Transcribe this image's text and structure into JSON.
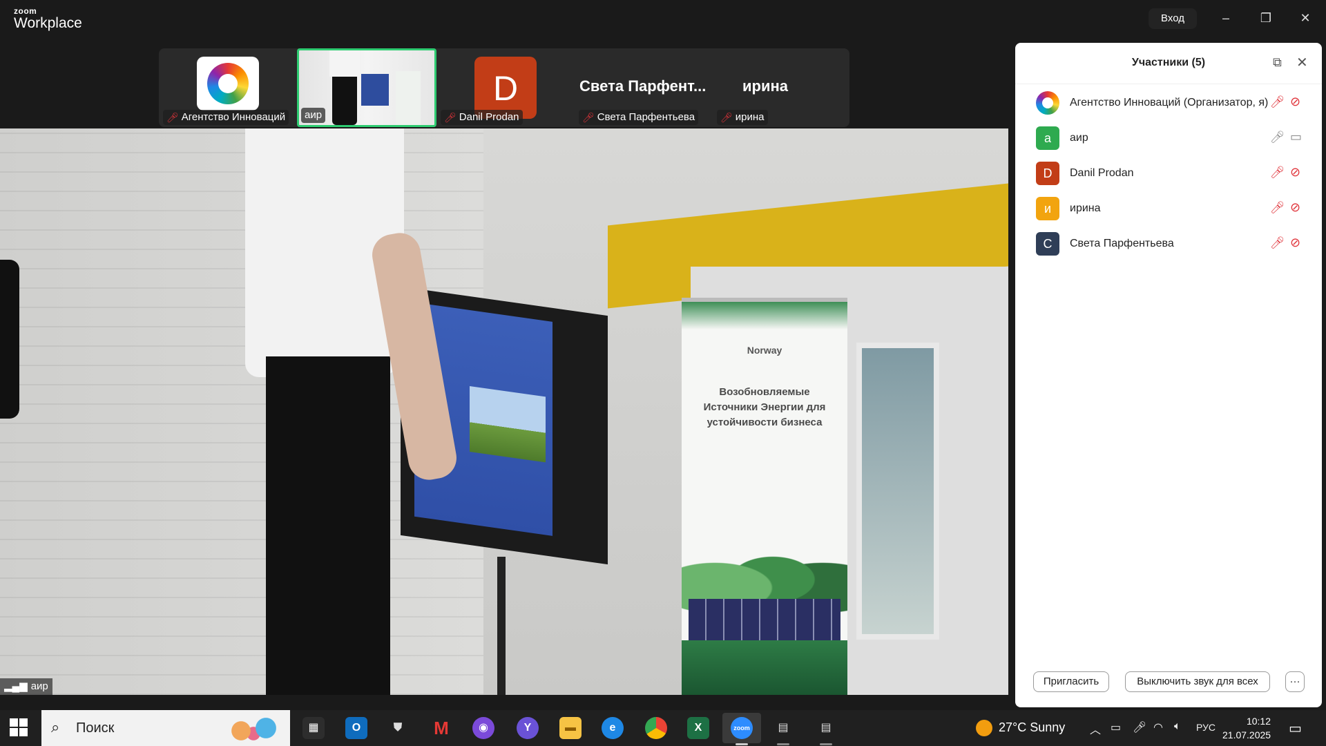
{
  "window": {
    "brand_top": "zoom",
    "brand_bottom": "Workplace",
    "signin_label": "Вход",
    "minimize_icon": "–",
    "restore_icon": "❐",
    "close_icon": "✕"
  },
  "thumbnails": [
    {
      "name": "Агентство Инноваций",
      "muted": true
    },
    {
      "name": "аир",
      "muted": false,
      "active_speaker": true
    },
    {
      "name": "Danil Prodan",
      "muted": true,
      "avatar_letter": "D"
    },
    {
      "name": "Света Парфентьева",
      "muted": true,
      "display_name": "Света Парфент..."
    },
    {
      "name": "ирина",
      "muted": true,
      "display_name": "ирина"
    }
  ],
  "main_video": {
    "speaker_name": "аир",
    "banner_logo_text": "Norway",
    "banner_text": "Возобновляемые Источники Энергии для устойчивости бизнеса"
  },
  "participants_panel": {
    "title": "Участники (5)",
    "participants": [
      {
        "name": "Агентство Инноваций (Организатор, я)",
        "avatar": "logo",
        "mic": "muted",
        "camera": "off"
      },
      {
        "name": "аир",
        "avatar_letter": "а",
        "avatar_color": "#2eaa4f",
        "mic": "on",
        "camera": "on"
      },
      {
        "name": "Danil Prodan",
        "avatar_letter": "D",
        "avatar_color": "#c23d17",
        "mic": "muted",
        "camera": "off"
      },
      {
        "name": "ирина",
        "avatar_letter": "и",
        "avatar_color": "#f2a40f",
        "mic": "muted",
        "camera": "off"
      },
      {
        "name": "Света Парфентьева",
        "avatar_letter": "С",
        "avatar_color": "#2f3e57",
        "mic": "muted",
        "camera": "off"
      }
    ],
    "invite_label": "Пригласить",
    "mute_all_label": "Выключить звук для всех",
    "more_label": "···"
  },
  "taskbar": {
    "search_placeholder": "Поиск",
    "weather": "27°C  Sunny",
    "language": "РУС",
    "time": "10:12",
    "date": "21.07.2025"
  }
}
